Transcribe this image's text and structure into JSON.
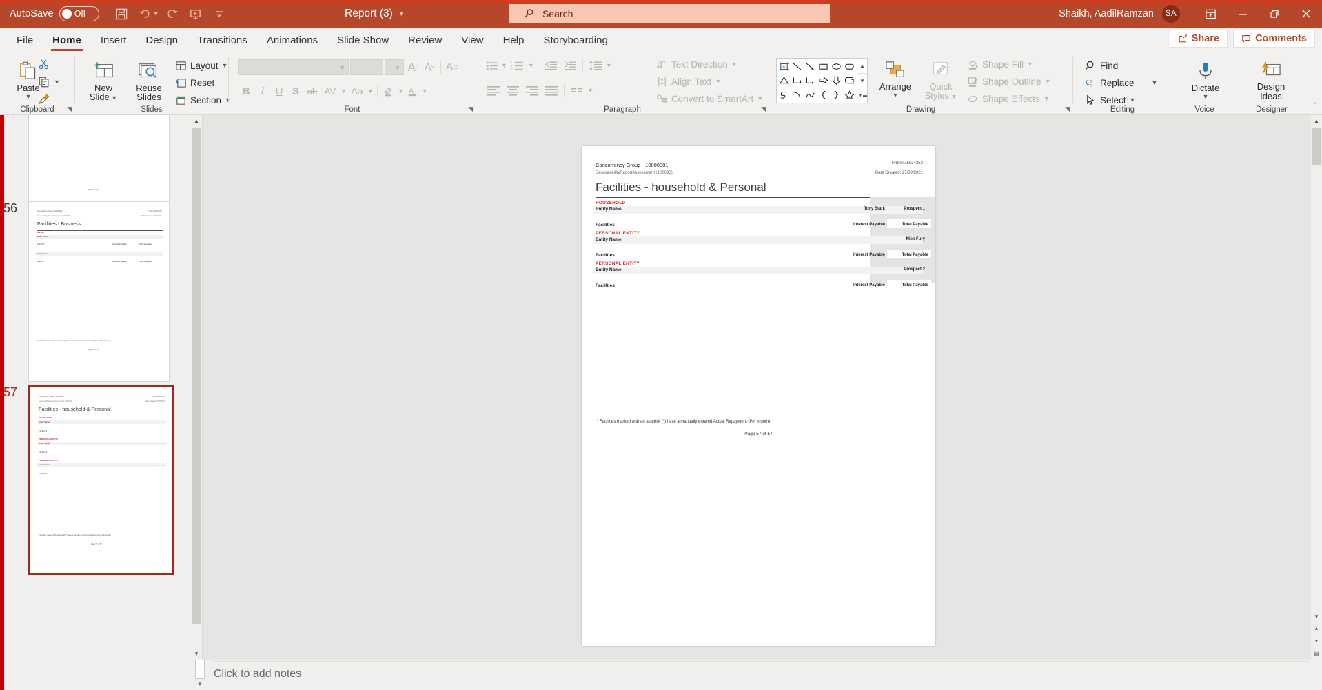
{
  "titlebar": {
    "autosave_label": "AutoSave",
    "autosave_state": "Off",
    "save_icon": "save-icon",
    "undo_icon": "undo-icon",
    "redo_icon": "redo-icon",
    "present_icon": "start-presentation-icon",
    "customize_icon": "customize-quick-access-icon",
    "document_title": "Report (3)",
    "user_name": "Shaikh, AadilRamzan",
    "avatar_initials": "SA",
    "ribbon_display_icon": "ribbon-display-options-icon",
    "minimize_icon": "minimize-icon",
    "restore_icon": "restore-icon",
    "close_icon": "close-icon",
    "accent_color": "#b7472a"
  },
  "search": {
    "placeholder": "Search",
    "icon": "search-icon"
  },
  "tabs": [
    {
      "label": "File",
      "active": false
    },
    {
      "label": "Home",
      "active": true
    },
    {
      "label": "Insert",
      "active": false
    },
    {
      "label": "Design",
      "active": false
    },
    {
      "label": "Transitions",
      "active": false
    },
    {
      "label": "Animations",
      "active": false
    },
    {
      "label": "Slide Show",
      "active": false
    },
    {
      "label": "Review",
      "active": false
    },
    {
      "label": "View",
      "active": false
    },
    {
      "label": "Help",
      "active": false
    },
    {
      "label": "Storyboarding",
      "active": false
    }
  ],
  "tabbar_right": {
    "share_label": "Share",
    "comments_label": "Comments"
  },
  "ribbon": {
    "groups": [
      {
        "name": "Clipboard",
        "label": "Clipboard"
      },
      {
        "name": "Slides",
        "label": "Slides"
      },
      {
        "name": "Font",
        "label": "Font"
      },
      {
        "name": "Paragraph",
        "label": "Paragraph"
      },
      {
        "name": "Drawing",
        "label": "Drawing"
      },
      {
        "name": "Editing",
        "label": "Editing"
      },
      {
        "name": "Voice",
        "label": "Voice"
      },
      {
        "name": "Designer",
        "label": "Designer"
      }
    ],
    "clipboard": {
      "paste_label": "Paste",
      "cut_icon": "scissors-icon",
      "copy_icon": "copy-icon",
      "format_painter_icon": "format-painter-icon"
    },
    "slides": {
      "new_slide_label": "New\nSlide",
      "new_slide_line1": "New",
      "new_slide_line2": "Slide",
      "reuse_slides_line1": "Reuse",
      "reuse_slides_line2": "Slides",
      "layout_label": "Layout",
      "reset_label": "Reset",
      "section_label": "Section"
    },
    "font": {
      "font_name_value": "",
      "font_size_value": "",
      "bold": "B",
      "italic": "I",
      "underline": "U",
      "shadow": "S",
      "strikethrough": "ab",
      "character_spacing": "AV",
      "change_case": "Aa",
      "increase_size": "A",
      "decrease_size": "A",
      "clear_formatting_icon": "clear-formatting-icon",
      "text_highlight_icon": "text-highlight-icon",
      "font_color_icon": "font-color-icon"
    },
    "paragraph": {
      "bullets_icon": "bullets-icon",
      "numbering_icon": "numbering-icon",
      "decrease_indent_icon": "decrease-indent-icon",
      "increase_indent_icon": "increase-indent-icon",
      "line_spacing_icon": "line-spacing-icon",
      "align_left_icon": "align-left-icon",
      "align_center_icon": "align-center-icon",
      "align_right_icon": "align-right-icon",
      "justify_icon": "justify-icon",
      "columns_icon": "columns-icon",
      "text_direction_label": "Text Direction",
      "align_text_label": "Align Text",
      "convert_smartart_label": "Convert to SmartArt"
    },
    "drawing": {
      "arrange_label": "Arrange",
      "quick_styles_line1": "Quick",
      "quick_styles_line2": "Styles",
      "shape_fill_label": "Shape Fill",
      "shape_outline_label": "Shape Outline",
      "shape_effects_label": "Shape Effects",
      "shapes": [
        "textbox-shape",
        "line-shape",
        "arrow-shape",
        "rectangle-shape",
        "oval-shape",
        "rounded-rectangle-shape",
        "triangle-shape",
        "elbow-connector-shape",
        "elbow-arrow-connector-shape",
        "right-arrow-shape",
        "down-arrow-shape",
        "flowchart-shape",
        "scribble-shape",
        "curve-shape",
        "arc-shape",
        "left-brace-shape",
        "right-brace-shape",
        "star-shape"
      ]
    },
    "editing": {
      "find_label": "Find",
      "replace_label": "Replace",
      "select_label": "Select"
    },
    "voice": {
      "dictate_label": "Dictate",
      "icon": "microphone-icon"
    },
    "designer": {
      "line1": "Design",
      "line2": "Ideas",
      "icon": "design-ideas-icon"
    }
  },
  "thumbnails": [
    {
      "number": "",
      "selected": false,
      "title": "",
      "partial": true
    },
    {
      "number": "56",
      "selected": false,
      "title": "Facilities - Business",
      "header_left1": "Concurrency Group - 10000081",
      "header_left2": "ServiceabilityReportAssessment (100035)",
      "header_right1": "FNFISla5634252",
      "header_right2": "Date Created: 27/09/2021",
      "sections": [
        "ENTITY"
      ],
      "footnote": "* Facilities marked with an asterisk (*) have a manually entered Actual Repayment (Per month)",
      "page": "Page 56 of 57"
    },
    {
      "number": "57",
      "selected": true,
      "title": "Facilities - household & Personal",
      "header_left1": "Concurrency Group - 10000081",
      "header_left2": "ServiceabilityReportAssessment (100035)",
      "header_right1": "FNFISla5634252",
      "header_right2": "Date Created: 27/09/2021",
      "sections": [
        "HOUSEHOLD",
        "PERSONAL ENTITY",
        "PERSONAL ENTITY"
      ],
      "footnote": "* Facilities marked with an asterisk (*) have a manually entered Actual Repayment (Per month)",
      "page": "Page 57 of 57"
    }
  ],
  "slide": {
    "header_left_1": "Concurrency Group - 10000081",
    "header_left_2": "ServiceabilityReportAssessment (100035)",
    "header_right_1": "FNFISla5634252",
    "header_right_2": "Date Created: 27/09/2021",
    "title": "Facilities - household & Personal",
    "blocks": [
      {
        "section_label": "HOUSEHOLD",
        "entity_row_label": "Entity Name",
        "entity_col_1": "Tony Stark",
        "entity_col_2": "Prospect 1",
        "facilities_label": "Facilities",
        "facilities_col_1": "Interest Payable",
        "facilities_col_2": "Total Payable"
      },
      {
        "section_label": "PERSONAL ENTITY",
        "entity_row_label": "Entity Name",
        "entity_col_1": "",
        "entity_col_2": "Nick Fury",
        "facilities_label": "Facilities",
        "facilities_col_1": "Interest Payable",
        "facilities_col_2": "Total Payable"
      },
      {
        "section_label": "PERSONAL ENTITY",
        "entity_row_label": "Entity Name",
        "entity_col_1": "",
        "entity_col_2": "Prospect 2",
        "facilities_label": "Facilities",
        "facilities_col_1": "Interest Payable",
        "facilities_col_2": "Total Payable"
      }
    ],
    "footnote": "* Facilities marked with an asterisk (*) have a manually entered Actual Repayment (Per month)",
    "page_number": "Page 57 of 57"
  },
  "notes": {
    "placeholder": "Click to add notes"
  }
}
